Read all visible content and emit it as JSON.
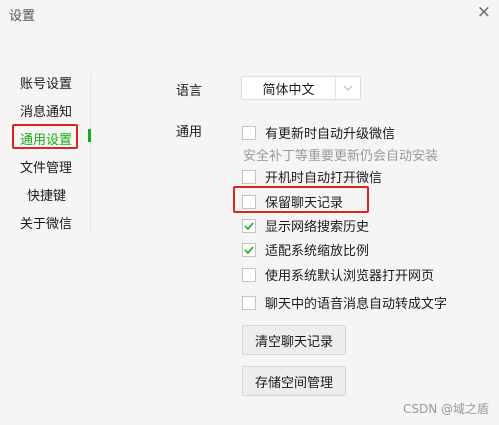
{
  "window": {
    "title": "设置",
    "close_label": "×"
  },
  "sidebar": {
    "items": [
      {
        "label": "账号设置"
      },
      {
        "label": "消息通知"
      },
      {
        "label": "通用设置",
        "active": true
      },
      {
        "label": "文件管理"
      },
      {
        "label": "快捷键"
      },
      {
        "label": "关于微信"
      }
    ]
  },
  "general": {
    "language": {
      "label": "语言",
      "value": "简体中文"
    },
    "section_label": "通用",
    "options": [
      {
        "label": "有更新时自动升级微信",
        "checked": false
      },
      {
        "label": "开机时自动打开微信",
        "checked": false
      },
      {
        "label": "保留聊天记录",
        "checked": false
      },
      {
        "label": "显示网络搜索历史",
        "checked": true
      },
      {
        "label": "适配系统缩放比例",
        "checked": true
      },
      {
        "label": "使用系统默认浏览器打开网页",
        "checked": false
      },
      {
        "label": "聊天中的语音消息自动转成文字",
        "checked": false
      }
    ],
    "update_hint": "安全补丁等重要更新仍会自动安装",
    "buttons": {
      "clear_history": "清空聊天记录",
      "storage": "存储空间管理"
    }
  },
  "watermark": "CSDN @域之盾",
  "colors": {
    "accent": "#1aad19",
    "highlight": "#d9271e"
  }
}
